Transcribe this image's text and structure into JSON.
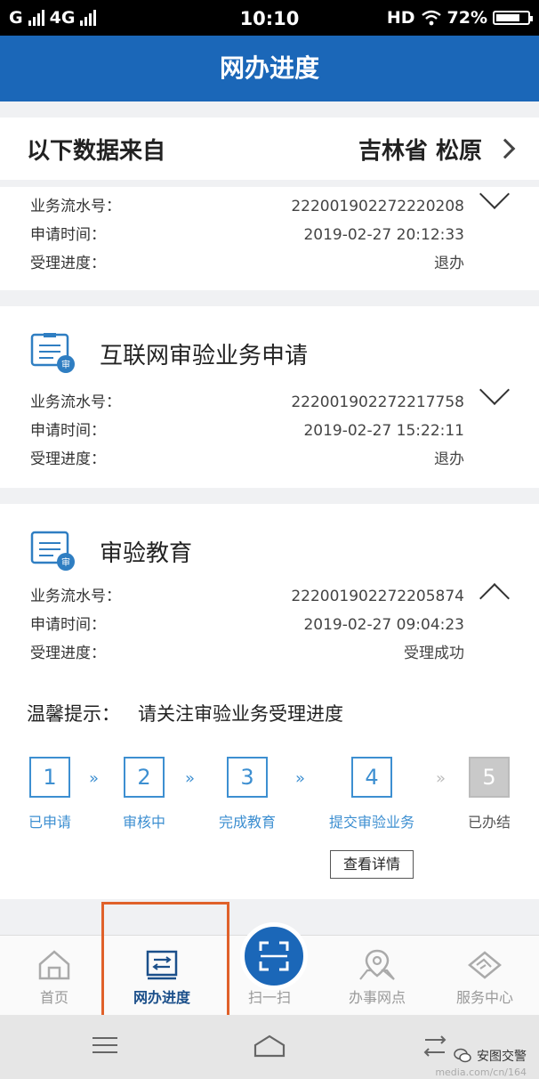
{
  "status_bar": {
    "carrier1": "G",
    "carrier2": "4G",
    "time": "10:10",
    "hd": "HD",
    "battery": "72%"
  },
  "header": {
    "title": "网办进度"
  },
  "region": {
    "label": "以下数据来自",
    "value": "吉林省 松原"
  },
  "labels": {
    "serial": "业务流水号：",
    "time": "申请时间：",
    "progress": "受理进度："
  },
  "records": [
    {
      "title": "",
      "serial": "222001902272220208",
      "time": "2019-02-27 20:12:33",
      "progress": "退办",
      "expanded": false
    },
    {
      "title": "互联网审验业务申请",
      "serial": "222001902272217758",
      "time": "2019-02-27 15:22:11",
      "progress": "退办",
      "expanded": false
    },
    {
      "title": "审验教育",
      "serial": "222001902272205874",
      "time": "2019-02-27 09:04:23",
      "progress": "受理成功",
      "expanded": true
    }
  ],
  "tip": {
    "label": "温馨提示：",
    "text": "请关注审验业务受理进度"
  },
  "steps": [
    {
      "num": "1",
      "label": "已申请"
    },
    {
      "num": "2",
      "label": "审核中"
    },
    {
      "num": "3",
      "label": "完成教育"
    },
    {
      "num": "4",
      "label": "提交审验业务"
    },
    {
      "num": "5",
      "label": "已办结"
    }
  ],
  "step_arrow": "»",
  "detail_button": "查看详情",
  "tabs": [
    {
      "label": "首页",
      "icon": "home-icon"
    },
    {
      "label": "网办进度",
      "icon": "progress-icon"
    },
    {
      "label": "扫一扫",
      "icon": "scan-icon"
    },
    {
      "label": "办事网点",
      "icon": "location-icon"
    },
    {
      "label": "服务中心",
      "icon": "handshake-icon"
    }
  ],
  "watermark": {
    "name": "安图交警",
    "url": "media.com/cn/164"
  },
  "colors": {
    "header": "#1b67b8",
    "step_accent": "#3d8fd1",
    "highlight": "#e0612a"
  }
}
